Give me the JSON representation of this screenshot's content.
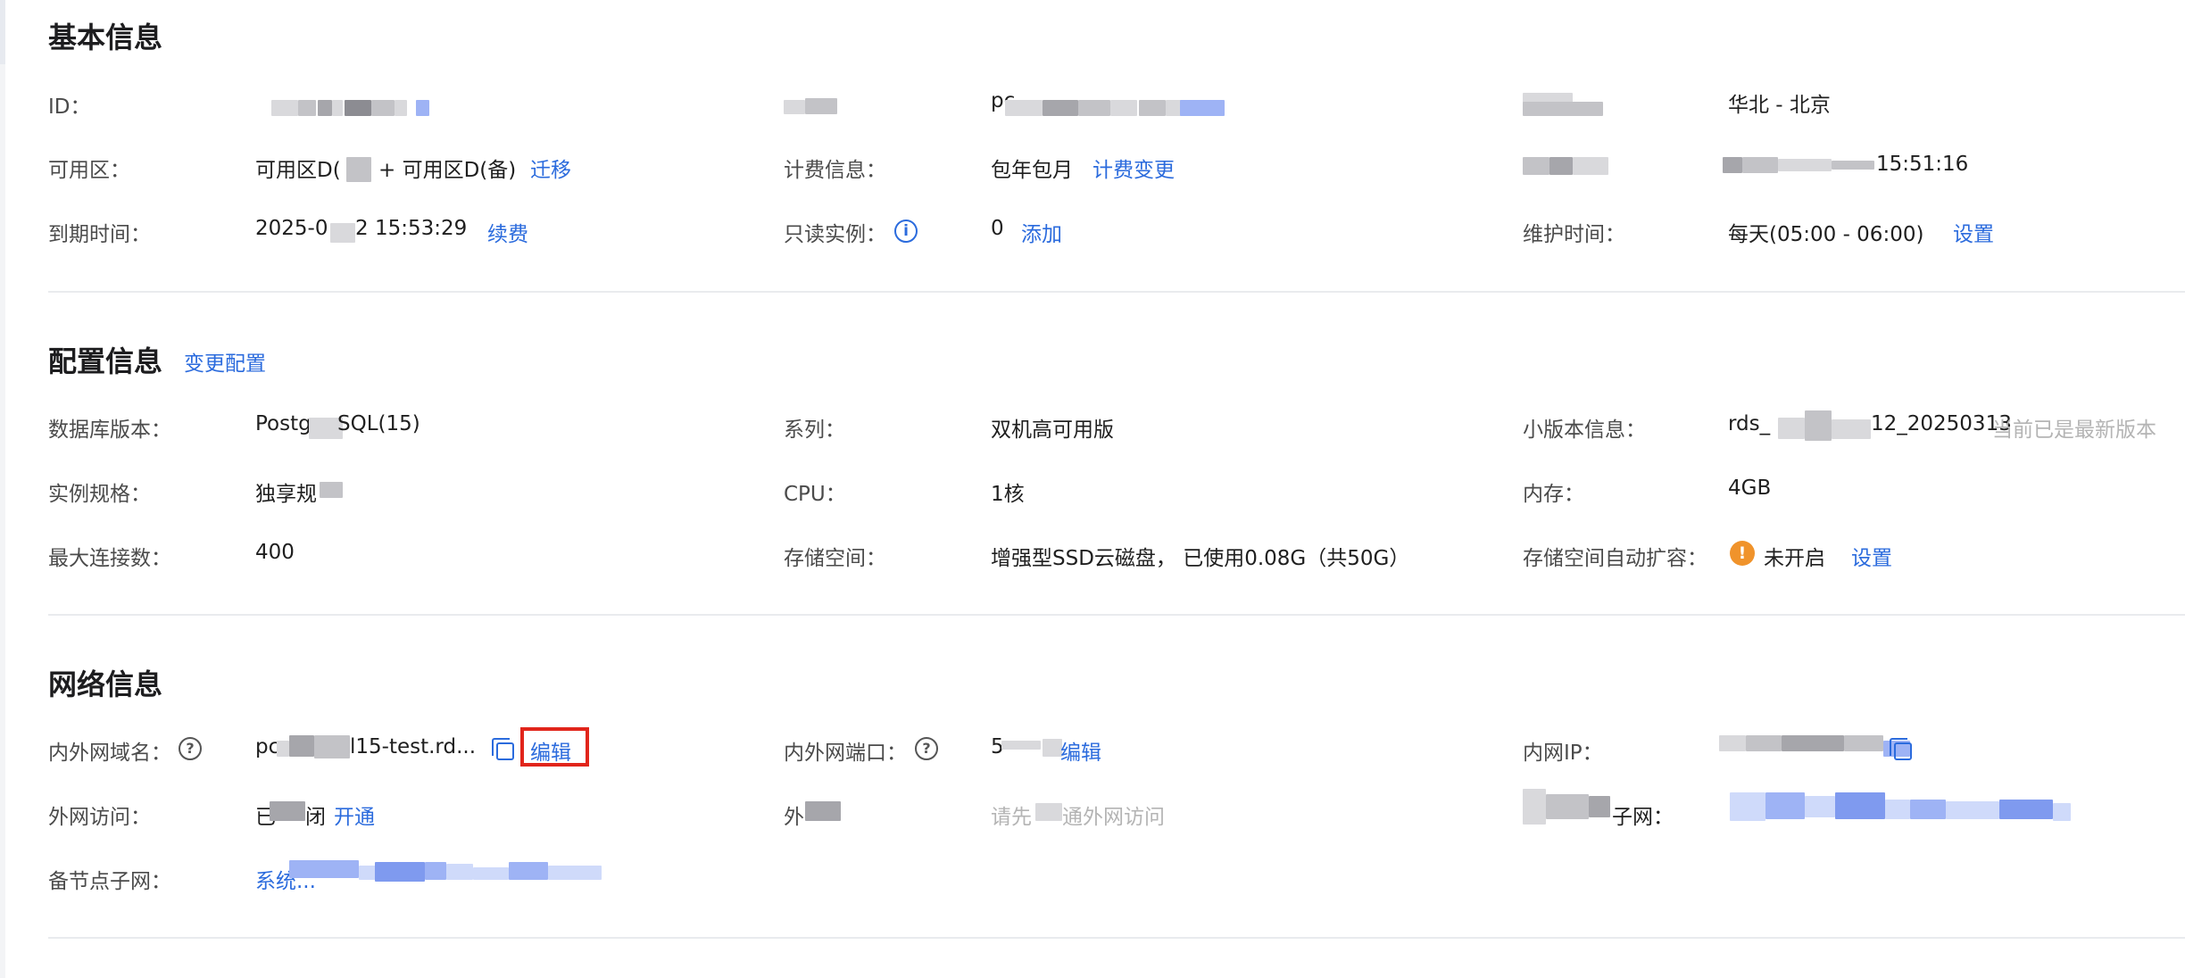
{
  "basic": {
    "title": "基本信息",
    "id_label": "ID：",
    "id_name_prefix": "pc",
    "region_value": "华北 - 北京",
    "zone_label": "可用区：",
    "zone_value_a": "可用区D(",
    "zone_value_b": "+ 可用区D(备)",
    "zone_link": "迁移",
    "billing_label": "计费信息：",
    "billing_value": "包年包月",
    "billing_link": "计费变更",
    "created_time_partial": "15:51:16",
    "expire_label": "到期时间：",
    "expire_value_a": "2025-0",
    "expire_value_b": "2 15:53:29",
    "expire_link": "续费",
    "readonly_label": "只读实例：",
    "readonly_value": "0",
    "readonly_link": "添加",
    "maint_label": "维护时间：",
    "maint_value": "每天(05:00 - 06:00)",
    "maint_link": "设置"
  },
  "config": {
    "title": "配置信息",
    "change_link": "变更配置",
    "dbver_label": "数据库版本：",
    "dbver_value_a": "Postg",
    "dbver_value_b": "SQL(15)",
    "series_label": "系列：",
    "series_value": "双机高可用版",
    "minor_label": "小版本信息：",
    "minor_value_a": "rds_",
    "minor_value_b": "12_20250313",
    "minor_note": "当前已是最新版本",
    "spec_label": "实例规格：",
    "spec_value": "独享规",
    "cpu_label": "CPU：",
    "cpu_value": "1核",
    "mem_label": "内存：",
    "mem_value": "4GB",
    "maxconn_label": "最大连接数：",
    "maxconn_value": "400",
    "storage_label": "存储空间：",
    "storage_value": "增强型SSD云磁盘， 已使用0.08G（共50G）",
    "autoexp_label": "存储空间自动扩容：",
    "autoexp_value": "未开启",
    "autoexp_link": "设置"
  },
  "network": {
    "title": "网络信息",
    "domain_label": "内外网域名：",
    "domain_value_a": "pc",
    "domain_value_b": "l15-test.rd...",
    "domain_edit": "编辑",
    "port_label": "内外网端口：",
    "port_value": "5",
    "port_edit": "编辑",
    "ip_label": "内网IP：",
    "extaccess_label": "外网访问：",
    "extaccess_value_a": "已",
    "extaccess_value_b": "闭",
    "extaccess_link": "开通",
    "extaddr_label_partial": "外",
    "extaddr_value_a": "请先",
    "extaddr_value_b": "通外网访问",
    "subnet_label_partial": "子网：",
    "backup_subnet_label": "备节点子网：",
    "backup_subnet_value_partial": "系统..."
  },
  "icons": {
    "info": "info-circle-icon",
    "help": "question-circle-icon",
    "warning": "warning-circle-icon",
    "copy": "copy-icon"
  },
  "colors": {
    "link": "#2b6bdd",
    "highlight_border": "#e1251b",
    "warning": "#f0932b"
  }
}
